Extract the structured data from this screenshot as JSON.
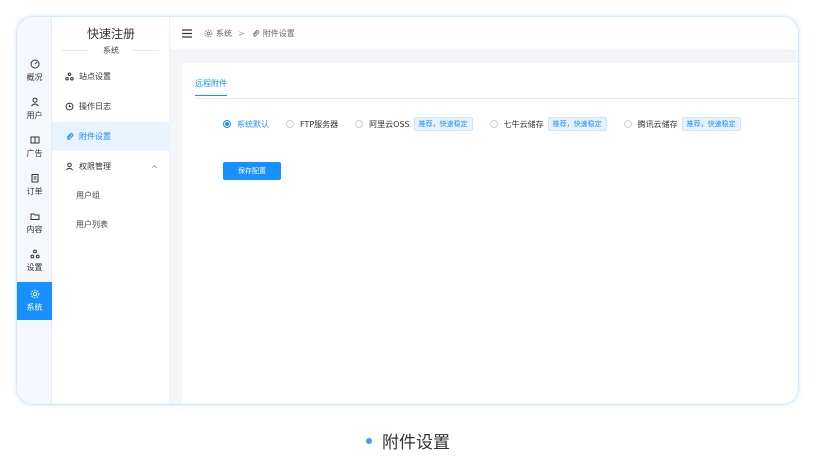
{
  "app_title": "快速注册",
  "sidebar": {
    "rail": [
      {
        "label": "概况",
        "icon": "dashboard-icon"
      },
      {
        "label": "用户",
        "icon": "user-icon"
      },
      {
        "label": "广告",
        "icon": "ad-icon"
      },
      {
        "label": "订单",
        "icon": "clipboard-icon"
      },
      {
        "label": "内容",
        "icon": "folder-icon"
      },
      {
        "label": "设置",
        "icon": "cluster-icon"
      },
      {
        "label": "系统",
        "icon": "gear-icon",
        "active": true
      }
    ],
    "section_title": "系统",
    "menu": [
      {
        "label": "站点设置",
        "icon": "cluster-icon"
      },
      {
        "label": "操作日志",
        "icon": "history-icon"
      },
      {
        "label": "附件设置",
        "icon": "paperclip-icon",
        "active": true
      },
      {
        "label": "权限管理",
        "icon": "user-icon",
        "expanded": true
      }
    ],
    "submenu": [
      {
        "label": "用户组"
      },
      {
        "label": "用户列表"
      }
    ]
  },
  "breadcrumb": {
    "root": "系统",
    "separator": ">",
    "current": "附件设置"
  },
  "tab": {
    "label": "远程附件"
  },
  "storage_options": [
    {
      "label": "系统默认",
      "checked": true
    },
    {
      "label": "FTP服务器"
    },
    {
      "label": "阿里云OSS",
      "badge": "推荐，快速稳定"
    },
    {
      "label": "七牛云储存",
      "badge": "推荐，快速稳定"
    },
    {
      "label": "腾讯云储存",
      "badge": "推荐，快速稳定"
    }
  ],
  "save_button": "保存配置",
  "caption": "附件设置",
  "colors": {
    "accent": "#1890ff",
    "rail_bg": "#f4f7fb",
    "content_bg": "#f3f5f8"
  }
}
